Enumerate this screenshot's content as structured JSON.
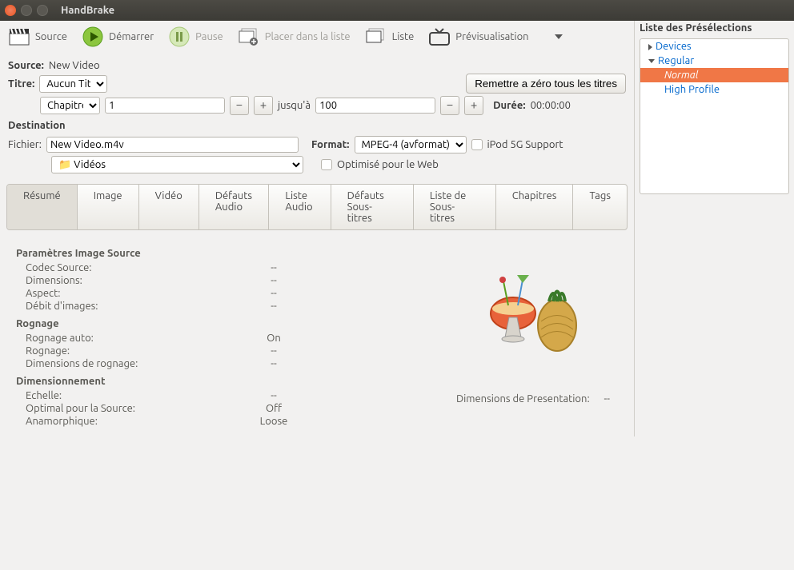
{
  "window": {
    "title": "HandBrake"
  },
  "toolbar": {
    "source": "Source",
    "start": "Démarrer",
    "pause": "Pause",
    "queue": "Placer dans la liste",
    "list": "Liste",
    "preview": "Prévisualisation"
  },
  "source": {
    "label": "Source:",
    "value": "New Video"
  },
  "title_row": {
    "label": "Titre:",
    "title_select": "Aucun Titre",
    "reset_btn": "Remettre a zéro tous les titres"
  },
  "range": {
    "mode": "Chapitres:",
    "from": "1",
    "to_label": "jusqu'à",
    "to": "100",
    "duration_label": "Durée:",
    "duration": "00:00:00"
  },
  "destination": {
    "header": "Destination",
    "file_label": "Fichier:",
    "file": "New Video.m4v",
    "folder": "Vidéos",
    "format_label": "Format:",
    "format": "MPEG-4 (avformat)",
    "ipod": "iPod 5G Support",
    "web": "Optimisé pour le Web"
  },
  "tabs": [
    "Résumé",
    "Image",
    "Vidéo",
    "Défauts Audio",
    "Liste Audio",
    "Défauts Sous-titres",
    "Liste de Sous-titres",
    "Chapitres",
    "Tags"
  ],
  "summary": {
    "src_params": "Paramètres Image Source",
    "codec": "Codec Source:",
    "dims": "Dimensions:",
    "aspect": "Aspect:",
    "fps": "Débit d'images:",
    "crop_h": "Rognage",
    "autocrop": "Rognage auto:",
    "autocrop_v": "On",
    "crop": "Rognage:",
    "crop_dims": "Dimensions de rognage:",
    "sizing_h": "Dimensionnement",
    "scale": "Echelle:",
    "optimal": "Optimal pour la Source:",
    "optimal_v": "Off",
    "anam": "Anamorphique:",
    "anam_v": "Loose",
    "pres_dims": "Dimensions de Presentation:",
    "dash": "--"
  },
  "presets": {
    "title": "Liste des Présélections",
    "groups": [
      {
        "name": "Devices",
        "open": false
      },
      {
        "name": "Regular",
        "open": true,
        "items": [
          "Normal",
          "High Profile"
        ],
        "selected": "Normal"
      }
    ]
  }
}
